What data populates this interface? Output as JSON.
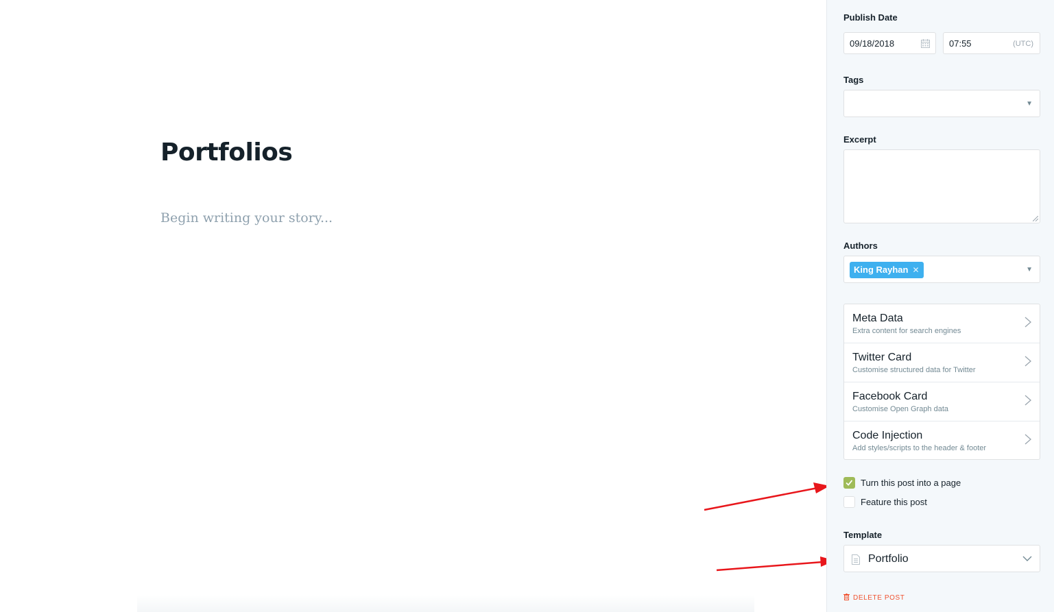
{
  "editor": {
    "title": "Portfolios",
    "body_placeholder": "Begin writing your story..."
  },
  "settings": {
    "publish_date": {
      "label": "Publish Date",
      "date": "09/18/2018",
      "time": "07:55",
      "timezone": "(UTC)"
    },
    "tags": {
      "label": "Tags",
      "value": ""
    },
    "excerpt": {
      "label": "Excerpt",
      "value": ""
    },
    "authors": {
      "label": "Authors",
      "items": [
        "King Rayhan"
      ]
    },
    "menu": [
      {
        "title": "Meta Data",
        "description": "Extra content for search engines"
      },
      {
        "title": "Twitter Card",
        "description": "Customise structured data for Twitter"
      },
      {
        "title": "Facebook Card",
        "description": "Customise Open Graph data"
      },
      {
        "title": "Code Injection",
        "description": "Add styles/scripts to the header & footer"
      }
    ],
    "checkboxes": {
      "page": {
        "label": "Turn this post into a page",
        "checked": true
      },
      "feature": {
        "label": "Feature this post",
        "checked": false
      }
    },
    "template": {
      "label": "Template",
      "value": "Portfolio"
    },
    "delete_label": "DELETE POST"
  },
  "colors": {
    "sidebar_bg": "#f4f8fb",
    "accent_blue": "#3eb0ef",
    "checkbox_green": "#9fbb58",
    "danger_red": "#f05230",
    "annotation_red": "#e8161b"
  },
  "icons": {
    "date_field": "calendar-icon",
    "dropdowns": "caret-down-icon",
    "menu_items": "chevron-right-icon",
    "template_field": "document-icon",
    "template_dropdown": "chevron-down-icon",
    "delete": "trash-icon",
    "checked": "checkmark-icon"
  }
}
